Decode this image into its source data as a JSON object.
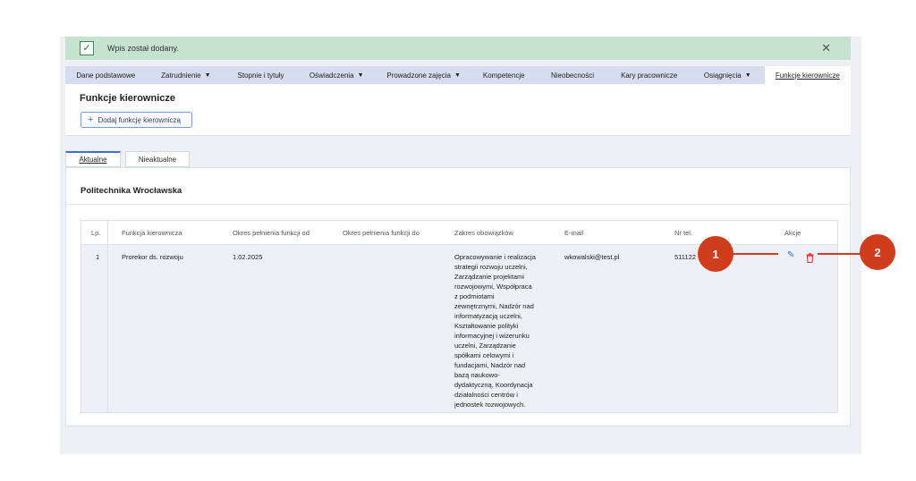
{
  "alert": {
    "text": "Wpis został dodany.",
    "check_icon": "check-icon",
    "close_icon": "close-icon",
    "close_glyph": "✕"
  },
  "tabs": [
    {
      "label": "Dane podstawowe",
      "dropdown": false
    },
    {
      "label": "Zatrudnienie",
      "dropdown": true
    },
    {
      "label": "Stopnie i tytuły",
      "dropdown": false
    },
    {
      "label": "Oświadczenia",
      "dropdown": true
    },
    {
      "label": "Prowadzone zajęcia",
      "dropdown": true
    },
    {
      "label": "Kompetencje",
      "dropdown": false
    },
    {
      "label": "Nieobecności",
      "dropdown": false
    },
    {
      "label": "Kary pracownicze",
      "dropdown": false
    },
    {
      "label": "Osiągnięcia",
      "dropdown": true
    },
    {
      "label": "Funkcje kierownicze",
      "dropdown": false,
      "active": true
    }
  ],
  "section": {
    "title": "Funkcje kierownicze",
    "add_button_label": "Dodaj funkcję kierowniczą",
    "plus_glyph": "+"
  },
  "subtabs": [
    {
      "label": "Aktualne",
      "active": true
    },
    {
      "label": "Nieaktualne",
      "active": false
    }
  ],
  "panel": {
    "title": "Politechnika Wrocławska"
  },
  "table": {
    "headers": [
      "Lp.",
      "Funkcja kierownicza",
      "Okres pełnienia funkcji od",
      "Okres pełnienia funkcji do",
      "Zakres obowiązków",
      "E-mail",
      "Nr tel.",
      "Akcje"
    ],
    "rows": [
      {
        "lp": "1",
        "function": "Prorekor ds. rozwoju",
        "from": "1.02.2025",
        "to": "",
        "duties": "Opracowywanie i realizacja strategii rozwoju uczelni, Zarządzanie projektami rozwojowymi, Współpraca z podmiotami zewnętrznymi, Nadzór nad informatyzacją uczelni, Kształtowanie polityki informacyjnej i wizerunku uczelni, Zarządzanie spółkami celowymi i fundacjami, Nadzór nad bazą naukowo-dydaktyczną, Koordynacja działalności centrów i jednostek rozwojowych.",
        "duties_lines": [
          "Opracowywanie i realizacja",
          "strategii rozwoju uczelni,",
          "Zarządzanie projektami",
          "rozwojowymi, Współpraca",
          "z podmiotami",
          "zewnętrznymi, Nadzór nad",
          "informatyzacją uczelni,",
          "Kształtowanie polityki",
          "informacyjnej i wizerunku",
          "uczelni, Zarządzanie",
          "spółkami celowymi i",
          "fundacjami, Nadzór nad",
          "bazą naukowo-",
          "dydaktyczną, Koordynacja",
          "działalności centrów i",
          "jednostek rozwojowych."
        ],
        "email": "wkowalski@test.pl",
        "phone": "511122",
        "actions": {
          "edit_icon": "pencil-icon",
          "delete_icon": "trash-icon",
          "edit_glyph": "✎"
        }
      }
    ]
  },
  "markers": [
    {
      "label": "1"
    },
    {
      "label": "2"
    }
  ],
  "colors": {
    "accent": "#3b6fd4",
    "delete": "#d23b2b",
    "marker": "#cf3d1d",
    "alert_bg": "#c6e3cf"
  }
}
